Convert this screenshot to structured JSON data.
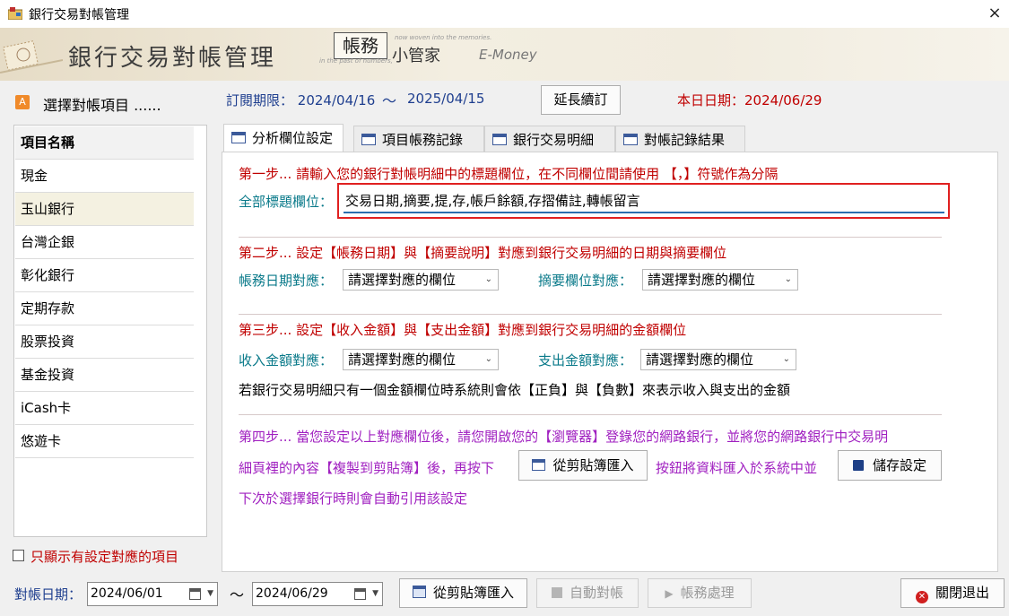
{
  "window": {
    "title": "銀行交易對帳管理",
    "close_icon": "×"
  },
  "banner": {
    "title": "銀行交易對帳管理",
    "brand": "帳務",
    "brand_sub": "小管家",
    "brand_en": "E-Money",
    "tagline_1": "now woven into the memories.",
    "tagline_2": "in the past of numbers,"
  },
  "left": {
    "header_icon": "A",
    "header": "選擇對帳項目 ......",
    "column_header": "項目名稱",
    "items": [
      "現金",
      "玉山銀行",
      "台灣企銀",
      "彰化銀行",
      "定期存款",
      "股票投資",
      "基金投資",
      "iCash卡",
      "悠遊卡"
    ],
    "selected_index": 1,
    "filter_label": "只顯示有設定對應的項目",
    "filter_checked": false
  },
  "info": {
    "subscription_label": "訂閱期限：",
    "sub_start": "2024/04/16",
    "tilde": "～",
    "sub_end": "2025/04/15",
    "extend_button": "延長續訂",
    "today_label": "本日日期：",
    "today": "2024/06/29"
  },
  "tabs": [
    "分析欄位設定",
    "項目帳務記錄",
    "銀行交易明細",
    "對帳記錄結果"
  ],
  "active_tab": 0,
  "step1": {
    "text": "第一步... 請輸入您的銀行對帳明細中的標題欄位，在不同欄位間請使用 【，】符號作為分隔",
    "field_label": "全部標題欄位：",
    "field_value": "交易日期,摘要,提,存,帳戶餘額,存摺備註,轉帳留言"
  },
  "step2": {
    "text": "第二步... 設定【帳務日期】與【摘要說明】對應到銀行交易明細的日期與摘要欄位",
    "date_label": "帳務日期對應：",
    "date_select": "請選擇對應的欄位",
    "memo_label": "摘要欄位對應：",
    "memo_select": "請選擇對應的欄位"
  },
  "step3": {
    "text": "第三步... 設定【收入金額】與【支出金額】對應到銀行交易明細的金額欄位",
    "income_label": "收入金額對應：",
    "income_select": "請選擇對應的欄位",
    "expense_label": "支出金額對應：",
    "expense_select": "請選擇對應的欄位",
    "note": "若銀行交易明細只有一個金額欄位時系統則會依【正負】與【負數】來表示收入與支出的金額"
  },
  "step4": {
    "line1": "第四步... 當您設定以上對應欄位後，請您開啟您的【瀏覽器】登錄您的網路銀行，並將您的網路銀行中交易明",
    "line2_a": "細頁裡的內容【複製到剪貼簿】後，再按下",
    "import_button": "從剪貼簿匯入",
    "line2_b": "按鈕將資料匯入於系統中並",
    "save_button": "儲存設定",
    "line3": "下次於選擇銀行時則會自動引用該設定"
  },
  "bottom": {
    "date_label": "對帳日期：",
    "date_from": "2024/06/01",
    "tilde": "～",
    "date_to": "2024/06/29",
    "import_button": "從剪貼簿匯入",
    "auto_button": "自動對帳",
    "process_button": "帳務處理",
    "exit_button": "關閉退出"
  },
  "colors": {
    "accent_red": "#c00000",
    "accent_blue": "#1f3f8f",
    "teal": "#0a7a8a",
    "purple": "#a020c0",
    "highlight_border": "#e02020"
  }
}
